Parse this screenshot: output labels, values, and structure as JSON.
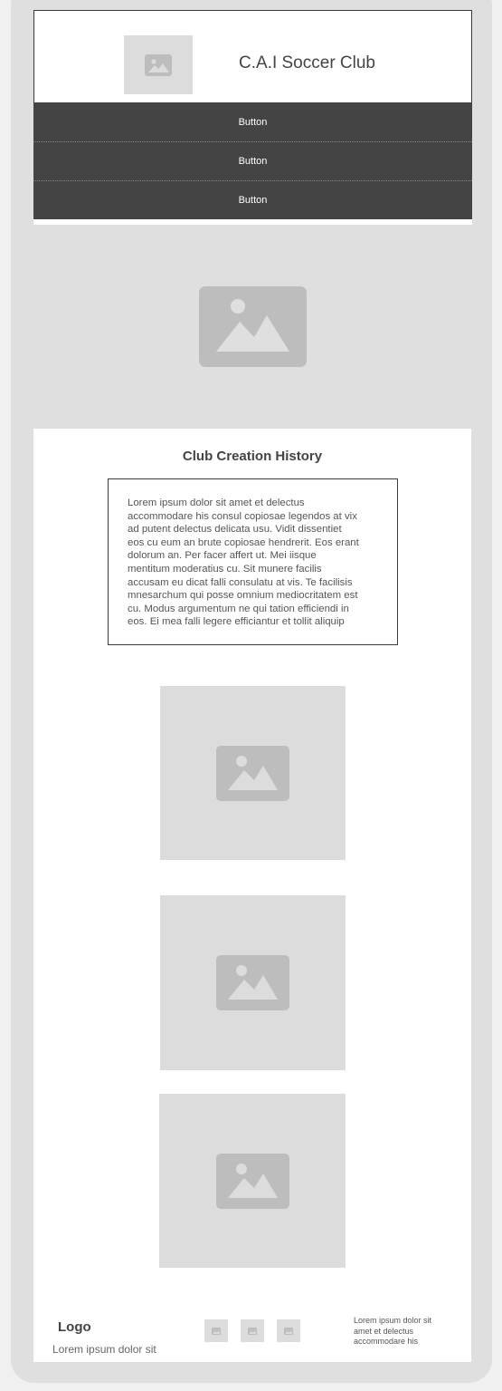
{
  "header": {
    "title": "C.A.I Soccer Club",
    "logo_icon": "image-placeholder-icon"
  },
  "nav": {
    "buttons": [
      "Button",
      "Button",
      "Button"
    ]
  },
  "hero": {
    "icon": "image-placeholder-icon"
  },
  "history": {
    "title": "Club Creation History",
    "lines": [
      "Lorem ipsum dolor sit amet et delectus",
      "accommodare his consul copiosae legendos at vix",
      "ad putent delectus delicata usu. Vidit dissentiet",
      "eos cu eum an brute copiosae hendrerit. Eos erant",
      "dolorum an. Per facer affert ut. Mei iisque",
      "mentitum moderatius cu. Sit munere facilis",
      "accusam eu dicat falli consulatu at vis. Te facilisis",
      "mnesarchum qui posse omnium mediocritatem est",
      "cu. Modus argumentum ne qui tation efficiendi in",
      "eos. Ei mea falli legere efficiantur et tollit aliquip"
    ]
  },
  "gallery": {
    "images": [
      "image-placeholder-icon",
      "image-placeholder-icon",
      "image-placeholder-icon"
    ]
  },
  "footer": {
    "logo": "Logo",
    "tagline": "Lorem ipsum dolor sit",
    "social_icons": [
      "social-icon",
      "social-icon",
      "social-icon"
    ],
    "text_lines": [
      "Lorem ipsum dolor sit",
      "amet et delectus",
      "accommodare his"
    ]
  },
  "colors": {
    "nav_bg": "#444444",
    "placeholder_bg": "#dcdcdc",
    "placeholder_icon": "#bdbdbd",
    "frame_bg": "#dfdfdf"
  }
}
